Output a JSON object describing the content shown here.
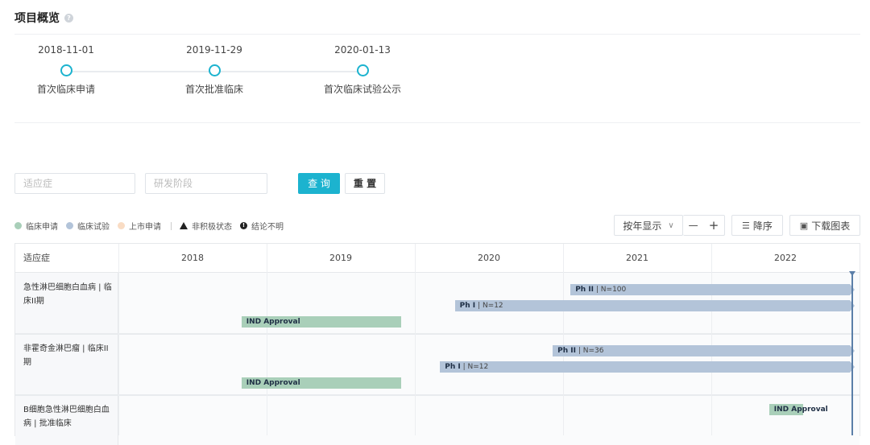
{
  "header": {
    "title": "项目概览",
    "help_glyph": "?"
  },
  "milestones": [
    {
      "date": "2018-11-01",
      "label": "首次临床申请"
    },
    {
      "date": "2019-11-29",
      "label": "首次批准临床"
    },
    {
      "date": "2020-01-13",
      "label": "首次临床试验公示"
    }
  ],
  "filters": {
    "indication_placeholder": "适应症",
    "phase_placeholder": "研发阶段",
    "query_label": "查 询",
    "reset_label": "重 置"
  },
  "legend": {
    "clinical_application": "临床申请",
    "clinical_trial": "临床试验",
    "market_application": "上市申请",
    "inactive": "非积极状态",
    "unclear": "结论不明",
    "colors": {
      "application": "#a9cfb9",
      "trial": "#b3c4d9",
      "market": "#f9dcc4"
    }
  },
  "toolbar": {
    "display_mode": "按年显示",
    "chevron": "∨",
    "zoom_out": "—",
    "zoom_in": "+",
    "sort": "降序",
    "download": "下载图表"
  },
  "timeline": {
    "header_label": "适应症",
    "years": [
      "2018",
      "2019",
      "2020",
      "2021",
      "2022"
    ],
    "rows": [
      {
        "label": "急性淋巴细胞白血病 | 临床II期",
        "bars": [
          {
            "type": "trial",
            "phase": "Ph II",
            "n": "N=100",
            "start": 2021.05,
            "end": 2023.0
          },
          {
            "type": "trial",
            "phase": "Ph I",
            "n": "N=12",
            "start": 2020.27,
            "end": 2023.0
          },
          {
            "type": "application",
            "text": "IND Approval",
            "start": 2018.83,
            "end": 2019.91
          }
        ]
      },
      {
        "label": "非霍奇金淋巴瘤 | 临床II期",
        "bars": [
          {
            "type": "trial",
            "phase": "Ph II",
            "n": "N=36",
            "start": 2020.93,
            "end": 2023.0
          },
          {
            "type": "trial",
            "phase": "Ph I",
            "n": "N=12",
            "start": 2020.17,
            "end": 2023.0
          },
          {
            "type": "application",
            "text": "IND Approval",
            "start": 2018.83,
            "end": 2019.91
          }
        ]
      },
      {
        "label": "B细胞急性淋巴细胞白血病 | 批准临床",
        "bars": [
          {
            "type": "application",
            "text": "IND Approval",
            "start": 2022.39,
            "end": 2022.62
          }
        ]
      }
    ],
    "today": 2023.0
  }
}
